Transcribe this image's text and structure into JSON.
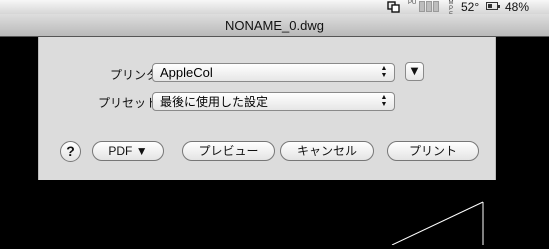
{
  "menubar": {
    "sync_icon": "sync-icon",
    "cpu_letters": "PU",
    "mem_letters": "M P E M",
    "temperature": "52°",
    "battery_percent": "48%",
    "battery_level": 0.48
  },
  "window": {
    "title": "NONAME_0.dwg"
  },
  "print_sheet": {
    "printer_label": "プリンタ：",
    "printer_value": "AppleCol",
    "preset_label": "プリセット：",
    "preset_value": "最後に使用した設定",
    "expand_icon": "▼",
    "help_label": "?",
    "pdf_label": "PDF ▼",
    "preview_label": "プレビュー",
    "cancel_label": "キャンセル",
    "print_label": "プリント"
  }
}
